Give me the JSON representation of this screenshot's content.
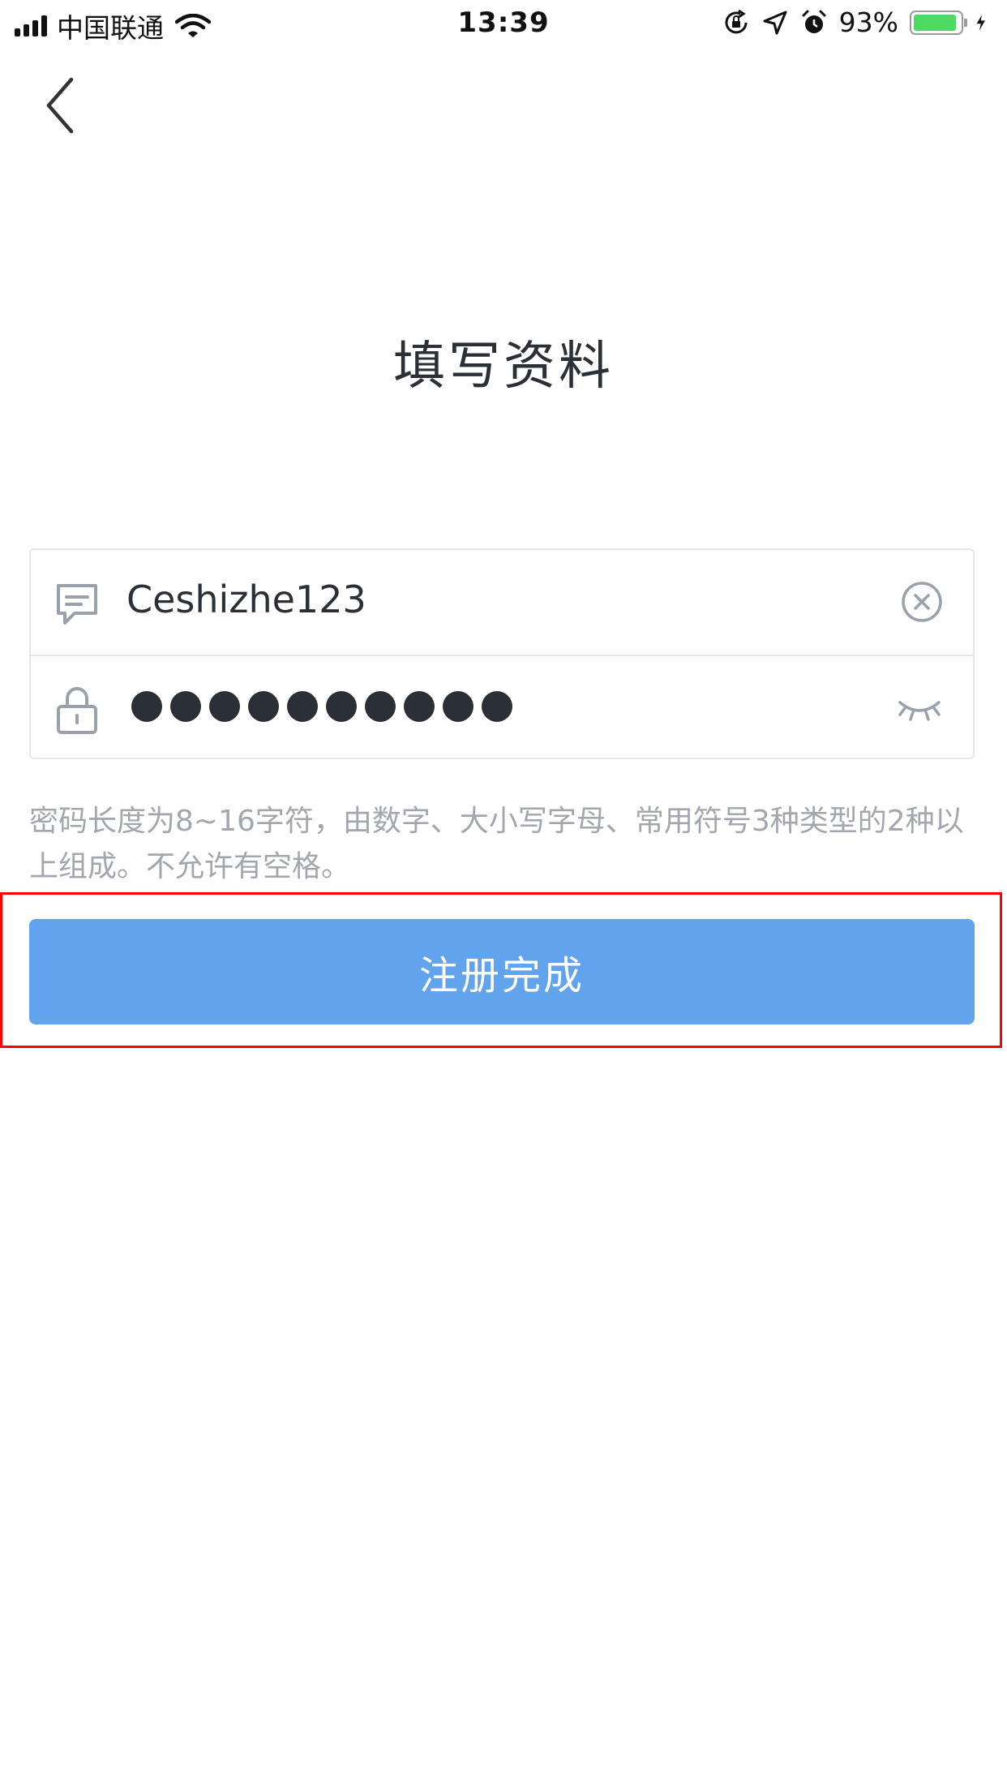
{
  "status_bar": {
    "carrier": "中国联通",
    "time": "13:39",
    "battery_percent": "93%",
    "battery_level": 0.93,
    "icons": [
      "signal-icon",
      "wifi-icon",
      "orientation-lock-icon",
      "location-arrow-icon",
      "alarm-icon",
      "battery-icon",
      "charging-icon"
    ]
  },
  "header": {
    "back_icon": "chevron-left-icon"
  },
  "page_title": "填写资料",
  "form": {
    "username": {
      "icon": "message-icon",
      "value": "Ceshizhe123",
      "clear_icon": "clear-circle-icon"
    },
    "password": {
      "icon": "lock-icon",
      "masked_value": "●●●●●●●●●●",
      "dot_count": 10,
      "toggle_icon": "eye-closed-icon"
    }
  },
  "hint": "密码长度为8~16字符，由数字、大小写字母、常用符号3种类型的2种以上组成。不允许有空格。",
  "submit": {
    "label": "注册完成",
    "color": "#62a3ee",
    "highlight_color": "#ff0000"
  }
}
